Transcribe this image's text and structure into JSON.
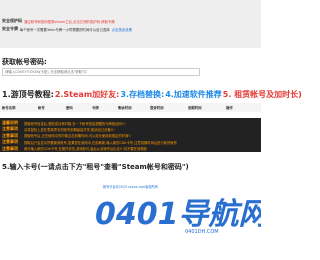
{
  "info": {
    "row1_label": "安全保护码",
    "row1_text": "通过帐号和密码登录steam之后,点击左侧的保护码,获取令牌",
    "row2_label": "安全令牌",
    "row2_text": "每个帐号一次需要3min令牌一小时需要的时间可以自己选择",
    "row2_link": "点击按此设置"
  },
  "search": {
    "title": "获取帐号密码:",
    "placeholder": "请输入CDKEY/TOKEN(卡密), 无法获取请点击\"获取\"中"
  },
  "banner": [
    {
      "text": "1.游顶号教程:",
      "color": "#222222"
    },
    {
      "text": "2.Steam加好友:",
      "color": "#e53935"
    },
    {
      "text": "3.存档替换:",
      "color": "#1e88e5"
    },
    {
      "text": "4.加速软件推荐",
      "color": "#1e88e5"
    },
    {
      "text": "5. 租赁帐号及加时长)",
      "color": "#e53935"
    }
  ],
  "table": {
    "headers": [
      "帐号名称",
      "帐号",
      "密码",
      "令牌",
      "剩余时间",
      "登录时间",
      "到期时间",
      "操作"
    ]
  },
  "notes": [
    {
      "label": "温馨说明",
      "text": "提取帐号信息后,登陆成功有时候,去一下帐号信息提醒的令牌验证码!!!"
    },
    {
      "label": "注意事项",
      "text": "请将鼠标上放在表事项中的帐号到期最高开关,取消自己设备!!!"
    },
    {
      "label": "注意事项",
      "text": "提取帐号后,正在使用中的时候点击到期时间,可以延长使用到指定的时间!!"
    },
    {
      "label": "注意事项",
      "text": "提取后只会显示所要使用帐号,如果您在使用中,在前刷新,输入新的CDK卡号,注意到期时间后进行新的帐号"
    },
    {
      "label": "注意事项",
      "text": "两次输入新的CDK卡号,在展开状态,游戏即可,最后从该帐号后出去!!!请不要在到期前"
    }
  ],
  "step": {
    "title": "5.输入卡号(一请点击下方\"租号\"查看\"Steam帐号和密码\")"
  },
  "footer": {
    "text": "帐号平台@2023 xxxxx.com版权所有"
  },
  "watermark": {
    "text": "0401导航网",
    "sub": "0401DH.COM",
    "color": "#2a6fd0"
  }
}
